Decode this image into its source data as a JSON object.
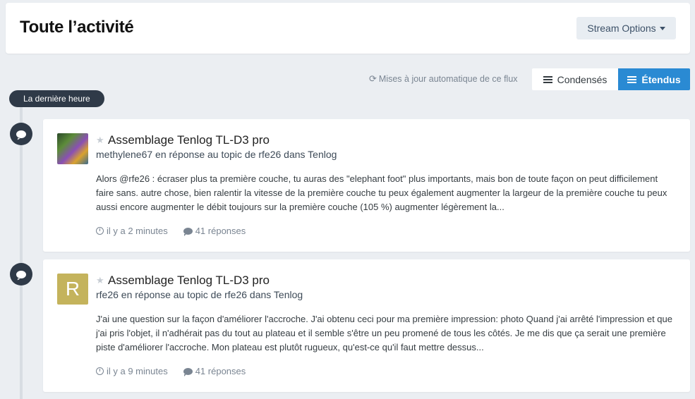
{
  "header": {
    "title": "Toute l’activité",
    "stream_options_label": "Stream Options"
  },
  "toolbar": {
    "auto_update_label": "Mises à jour automatique de ce flux",
    "view_condensed_label": "Condensés",
    "view_expanded_label": "Étendus",
    "active_view": "Étendus"
  },
  "timeline": {
    "period_label": "La dernière heure"
  },
  "items": [
    {
      "avatar_letter": "",
      "title": "Assemblage Tenlog TL-D3 pro",
      "subtitle": "methylene67 en réponse au topic de rfe26 dans Tenlog",
      "snippet": "Alors @rfe26 : écraser plus ta première couche, tu auras des \"elephant foot\" plus importants, mais bon de toute façon on peut difficilement faire sans. autre chose, bien ralentir la vitesse de la première couche tu peux également augmenter la largeur de la première couche tu peux aussi encore augmenter le débit toujours sur la première couche (105 %) augmenter légèrement la...",
      "time": "il y a 2 minutes",
      "replies": "41 réponses"
    },
    {
      "avatar_letter": "R",
      "title": "Assemblage Tenlog TL-D3 pro",
      "subtitle": "rfe26 en réponse au topic de rfe26 dans Tenlog",
      "snippet": "J'ai une question sur la façon d'améliorer l'accroche. J'ai obtenu ceci pour ma première impression: photo Quand j'ai arrêté l'impression et que j'ai pris l'objet, il n'adhérait pas du tout au plateau et il semble s'être un peu promené de tous les côtés. Je me dis que ça serait une première piste d'améliorer l'accroche. Mon plateau est plutôt rugueux, qu'est-ce qu'il faut mettre dessus...",
      "time": "il y a 9 minutes",
      "replies": "41 réponses"
    }
  ],
  "colors": {
    "accent": "#2a8ad3",
    "timeline_dark": "#2f3a48",
    "background": "#ebeef2",
    "avatar_r": "#c4b35c"
  },
  "icons": {
    "refresh": "refresh-icon",
    "list": "list-icon",
    "comment": "comment-icon",
    "star": "star-icon",
    "clock": "clock-icon"
  }
}
